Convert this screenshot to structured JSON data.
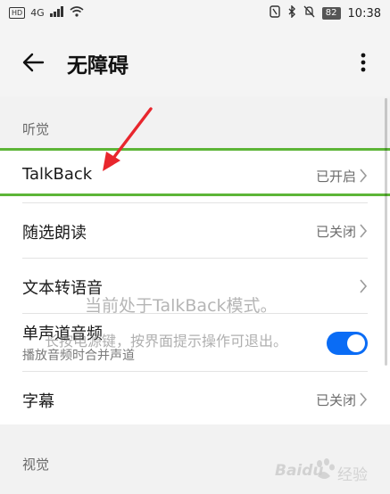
{
  "status_bar": {
    "hd": "HD",
    "network": "4G",
    "battery": "82",
    "time": "10:38"
  },
  "header": {
    "title": "无障碍"
  },
  "sections": [
    {
      "title": "听觉",
      "rows": [
        {
          "label": "TalkBack",
          "value": "已开启"
        },
        {
          "label": "随选朗读",
          "value": "已关闭"
        },
        {
          "label": "文本转语音",
          "value": ""
        },
        {
          "label": "单声道音频",
          "sublabel": "播放音频时合并声道",
          "toggle": true
        },
        {
          "label": "字幕",
          "value": "已关闭"
        }
      ]
    },
    {
      "title": "视觉"
    }
  ],
  "overlay": {
    "toast_line1": "当前处于TalkBack模式。",
    "toast_line2": "长按电源键，按界面提示操作可退出。"
  },
  "colors": {
    "accent": "#0a6cf5",
    "highlight": "#5db537",
    "arrow": "#e8262d"
  },
  "watermark": {
    "brand": "Baidu",
    "text": "经验"
  }
}
